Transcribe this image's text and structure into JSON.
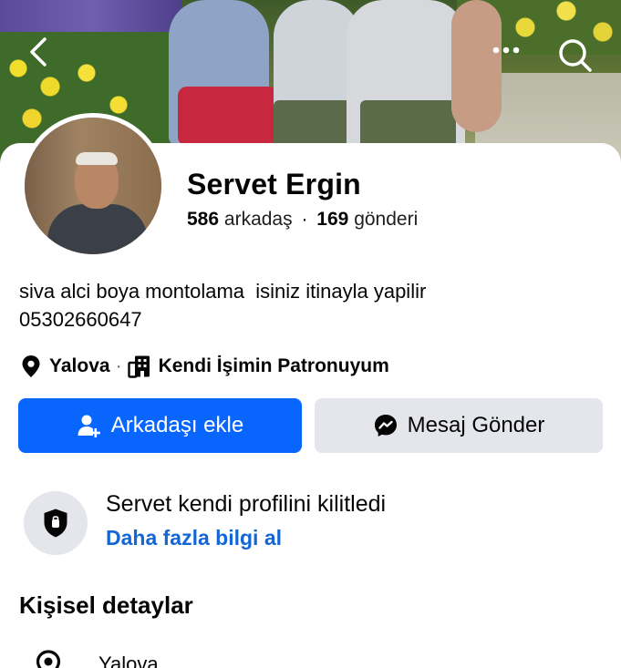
{
  "header": {
    "back_icon": "chevron-left-icon",
    "more_icon": "more-horizontal-icon",
    "search_icon": "search-icon"
  },
  "profile": {
    "name": "Servet Ergin",
    "friends_count": "586",
    "friends_label": "arkadaş",
    "stats_separator": "·",
    "posts_count": "169",
    "posts_label": "gönderi",
    "bio_line1": "siva alci boya montolama  isiniz itinayla yapilir",
    "bio_line2": "05302660647",
    "location": "Yalova",
    "meta_separator": "·",
    "work": "Kendi İşimin Patronuyum"
  },
  "actions": {
    "add_friend_label": "Arkadaşı ekle",
    "message_label": "Mesaj Gönder"
  },
  "lock_notice": {
    "title": "Servet kendi profilini kilitledi",
    "link": "Daha fazla bilgi al"
  },
  "details": {
    "section_title": "Kişisel detaylar",
    "location": "Yalova"
  },
  "colors": {
    "primary_button": "#0866ff",
    "secondary_button": "#e4e6eb",
    "link": "#1466d6"
  }
}
